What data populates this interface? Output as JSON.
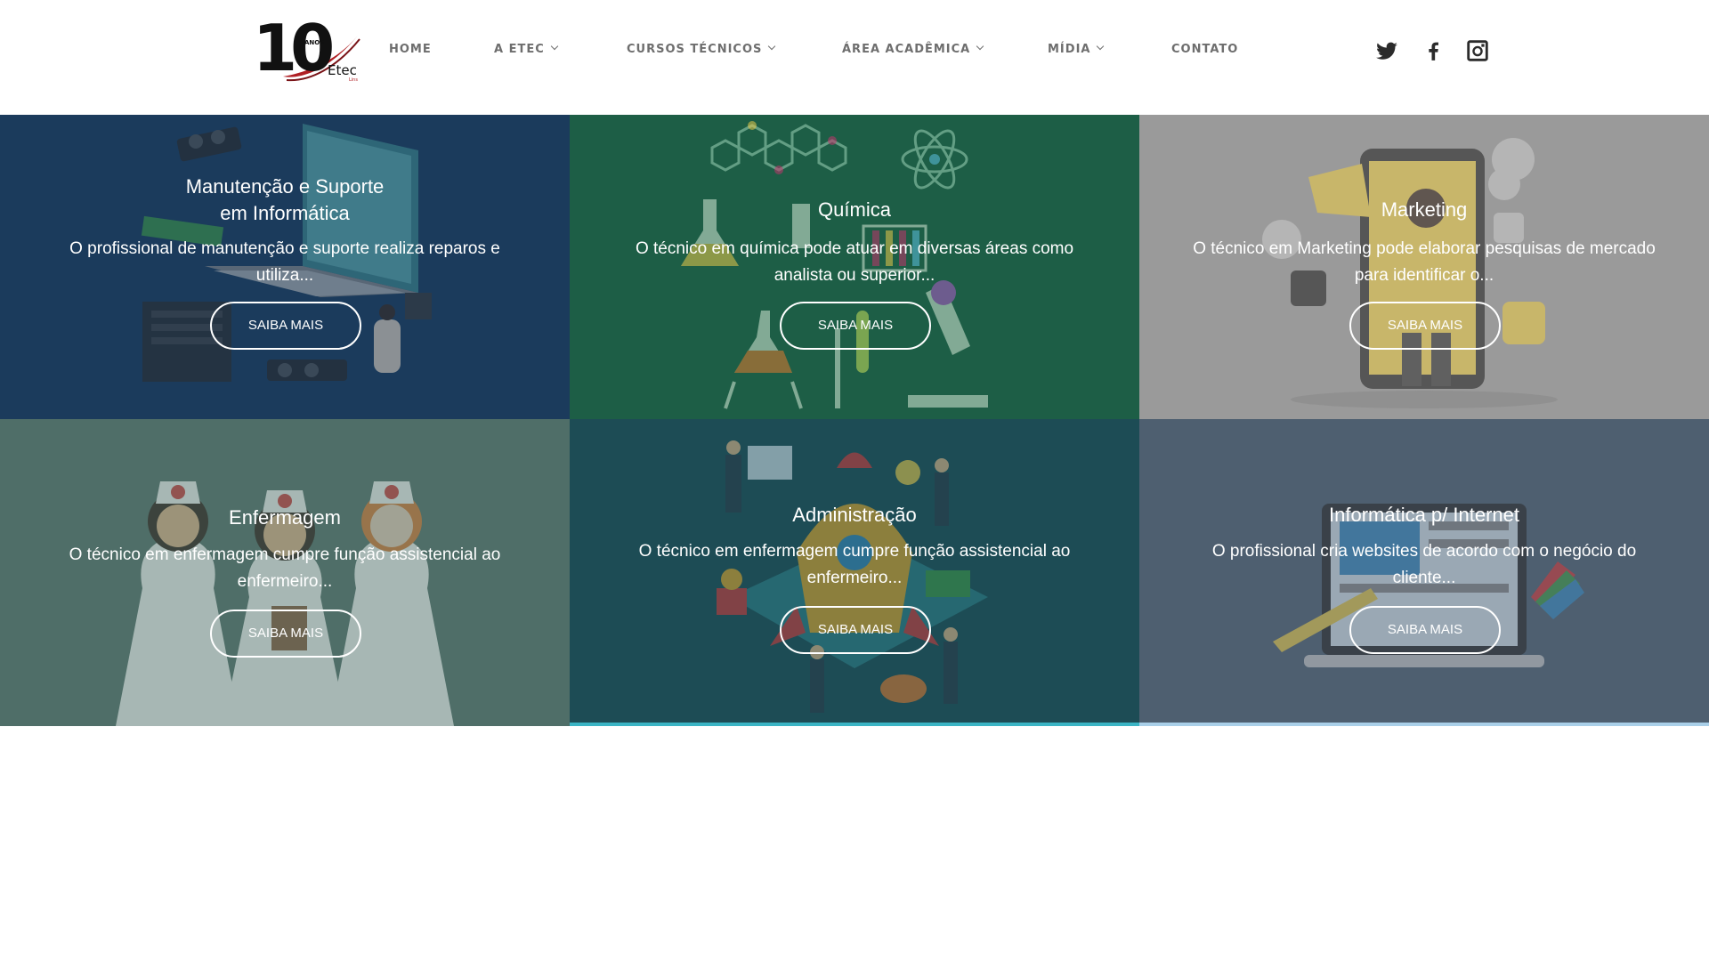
{
  "logo": {
    "number": "10",
    "tag": "ANOS",
    "brand": "Etec",
    "brand_sub": "Lins",
    "brand_color": "#b01f24"
  },
  "nav": {
    "items": [
      {
        "label": "HOME",
        "has_dropdown": false
      },
      {
        "label": "A ETEC",
        "has_dropdown": true
      },
      {
        "label": "CURSOS TÉCNICOS",
        "has_dropdown": true
      },
      {
        "label": "ÁREA ACADÊMICA",
        "has_dropdown": true
      },
      {
        "label": "MÍDIA",
        "has_dropdown": true
      },
      {
        "label": "CONTATO",
        "has_dropdown": false
      }
    ],
    "text_color": "#6e6e6e"
  },
  "social": [
    {
      "icon": "twitter-icon"
    },
    {
      "icon": "facebook-icon"
    },
    {
      "icon": "instagram-icon"
    }
  ],
  "courses": [
    {
      "title_lines": [
        "Manutenção e Suporte",
        "em Informática"
      ],
      "description": "O profissional de manutenção e suporte realiza reparos e utiliza...",
      "button": "SAIBA MAIS",
      "color": "#1b3b5c",
      "illustration": "computer-repair-illustration"
    },
    {
      "title_lines": [
        "Química"
      ],
      "description": "O técnico em química pode atuar em diversas áreas como analista ou superior...",
      "button": "SAIBA MAIS",
      "color": "#1d5e46",
      "illustration": "chemistry-lab-illustration"
    },
    {
      "title_lines": [
        "Marketing"
      ],
      "description": "O técnico em Marketing pode elaborar pesquisas de mercado para identificar o...",
      "button": "SAIBA MAIS",
      "color": "#9a9a9a",
      "illustration": "marketing-megaphone-illustration"
    },
    {
      "title_lines": [
        "Enfermagem"
      ],
      "description": "O técnico em enfermagem cumpre função assistencial ao enfermeiro...",
      "button": "SAIBA MAIS",
      "color": "#4f6e68",
      "illustration": "nurses-illustration"
    },
    {
      "title_lines": [
        "Administração"
      ],
      "description": "O técnico em enfermagem cumpre função assistencial ao enfermeiro...",
      "button": "SAIBA MAIS",
      "color": "#1d4c55",
      "illustration": "business-rocket-illustration"
    },
    {
      "title_lines": [
        "Informática p/ Internet"
      ],
      "description": "O profissional cria websites de acordo com o negócio do cliente...",
      "button": "SAIBA MAIS",
      "color": "#4e5f70",
      "illustration": "web-design-illustration"
    }
  ]
}
